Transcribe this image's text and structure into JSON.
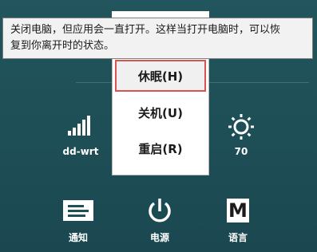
{
  "tooltip": {
    "line1": "关闭电脑，但应用会一直打开。这样当打开电脑时，可以恢",
    "line2": "复到你离开时的状态。"
  },
  "power_menu": {
    "items": [
      {
        "label": "休眠(H)",
        "selected": true
      },
      {
        "label": "关机(U)",
        "selected": false
      },
      {
        "label": "重启(R)",
        "selected": false
      }
    ]
  },
  "status": {
    "network_label": "dd-wrt",
    "network_icon": "wifi-signal-icon",
    "brightness_value": "70",
    "brightness_icon": "brightness-icon"
  },
  "bottom_buttons": [
    {
      "label": "通知",
      "icon": "notifications-icon"
    },
    {
      "label": "电源",
      "icon": "power-icon"
    },
    {
      "label": "语言",
      "icon": "keyboard-icon",
      "glyph": "M"
    }
  ],
  "colors": {
    "panel_background": "#1f4f57",
    "selected_border": "#d9534f",
    "menu_background": "#ffffff"
  }
}
